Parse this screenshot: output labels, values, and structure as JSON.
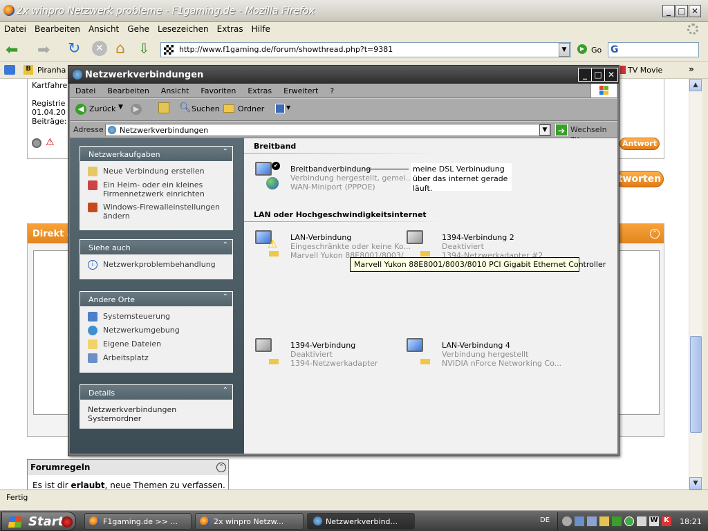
{
  "firefox": {
    "title": "2x winpro Netzwerk probleme - F1gaming.de - Mozilla Firefox",
    "menu": [
      "Datei",
      "Bearbeiten",
      "Ansicht",
      "Gehe",
      "Lesezeichen",
      "Extras",
      "Hilfe"
    ],
    "url": "http://www.f1gaming.de/forum/showthread.php?t=9381",
    "go_label": "Go",
    "search_value": "G",
    "bookmarks": [
      "Piranha",
      "TV Movie"
    ],
    "status": "Fertig"
  },
  "forum": {
    "user_lines": [
      "Kartfahre",
      "Registrie",
      "01.04.20",
      "Beiträge:"
    ],
    "antwort_small": "Antwort",
    "antworten_big": "tworten",
    "direkt_label": "Direkt a",
    "rules_title": "Forumregeln",
    "rules_text_pre": "Es ist dir",
    "rules_text_bold": "erlaubt",
    "rules_text_post": ", neue Themen zu verfassen."
  },
  "explorer": {
    "title": "Netzwerkverbindungen",
    "menu": [
      "Datei",
      "Bearbeiten",
      "Ansicht",
      "Favoriten",
      "Extras",
      "Erweitert",
      "?"
    ],
    "toolbar": {
      "back": "Zurück",
      "search": "Suchen",
      "folders": "Ordner"
    },
    "address_label": "Adresse",
    "address_value": "Netzwerkverbindungen",
    "go_label": "Wechseln zu",
    "panels": {
      "tasks": {
        "title": "Netzwerkaufgaben",
        "items": [
          "Neue Verbindung erstellen",
          "Ein Heim- oder ein kleines Firmennetzwerk einrichten",
          "Windows-Firewalleinstellungen ändern"
        ]
      },
      "see_also": {
        "title": "Siehe auch",
        "items": [
          "Netzwerkproblembehandlung"
        ]
      },
      "other": {
        "title": "Andere Orte",
        "items": [
          "Systemsteuerung",
          "Netzwerkumgebung",
          "Eigene Dateien",
          "Arbeitsplatz"
        ]
      },
      "details": {
        "title": "Details",
        "line1": "Netzwerkverbindungen",
        "line2": "Systemordner"
      }
    },
    "groups": {
      "broadband": "Breitband",
      "lan": "LAN oder Hochgeschwindigkeitsinternet"
    },
    "connections": {
      "bb": {
        "name": "Breitbandverbindung",
        "status": "Verbindung hergestellt, gemei...",
        "device": "WAN-Miniport (PPPOE)"
      },
      "lan1": {
        "name": "LAN-Verbindung",
        "status": "Eingeschränkte oder keine Ko...",
        "device": "Marvell Yukon 88E8001/8003/..."
      },
      "fw2": {
        "name": "1394-Verbindung 2",
        "status": "Deaktiviert",
        "device": "1394-Netzwerkadapter #2"
      },
      "fw1": {
        "name": "1394-Verbindung",
        "status": "Deaktiviert",
        "device": "1394-Netzwerkadapter"
      },
      "lan4": {
        "name": "LAN-Verbindung 4",
        "status": "Verbindung hergestellt",
        "device": "NVIDIA nForce Networking Co..."
      }
    },
    "annotation": "meine DSL Verbinudung über das internet gerade läuft.",
    "tooltip": "Marvell Yukon 88E8001/8003/8010 PCI Gigabit Ethernet Controller"
  },
  "taskbar": {
    "start": "Start",
    "tasks": [
      "F1gaming.de >> ...",
      "2x winpro Netzw...",
      "Netzwerkverbind..."
    ],
    "lang": "DE",
    "clock": "18:21"
  }
}
